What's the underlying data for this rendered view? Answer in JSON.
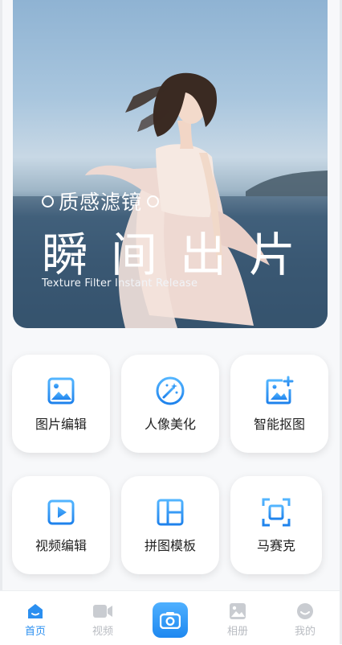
{
  "hero": {
    "subtitle": "质感滤镜",
    "headline": "瞬间出片",
    "tagline": "Texture Filter  Instant Release"
  },
  "tools": [
    {
      "label": "图片编辑",
      "icon": "image-icon"
    },
    {
      "label": "人像美化",
      "icon": "magic-wand-icon"
    },
    {
      "label": "智能抠图",
      "icon": "image-add-icon"
    },
    {
      "label": "视频编辑",
      "icon": "play-icon"
    },
    {
      "label": "拼图模板",
      "icon": "collage-icon"
    },
    {
      "label": "马赛克",
      "icon": "mosaic-icon"
    }
  ],
  "nav": {
    "home": "首页",
    "video": "视频",
    "album": "相册",
    "mine": "我的",
    "active": "home"
  },
  "colors": {
    "accent": "#2b8ff0",
    "inactive": "#b9bcc2"
  }
}
